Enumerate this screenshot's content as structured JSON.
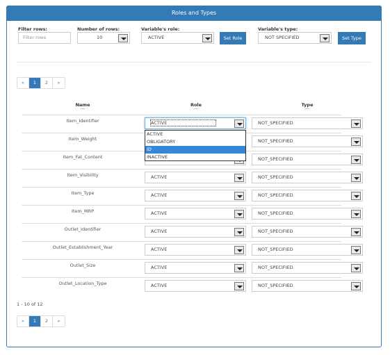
{
  "header": {
    "title": "Roles and Types"
  },
  "controls": {
    "filter_label": "Filter rows:",
    "filter_placeholder": "Filter rows",
    "rows_label": "Number of rows:",
    "rows_value": "10",
    "role_label": "Variable's role:",
    "role_value": "ACTIVE",
    "set_role": "Set Role",
    "type_label": "Variable's type:",
    "type_value": "NOT SPECIFIED",
    "set_type": "Set Type"
  },
  "pagination": {
    "prev": "«",
    "pages": [
      "1",
      "2"
    ],
    "active": "1",
    "next": "»"
  },
  "table": {
    "headers": [
      "Name",
      "Role",
      "Type"
    ],
    "rows": [
      {
        "name": "Item_Identifier",
        "role": "ACTIVE",
        "type": "NOT_SPECIFIED"
      },
      {
        "name": "Item_Weight",
        "role": "ACTIVE",
        "type": "NOT_SPECIFIED"
      },
      {
        "name": "Item_Fat_Content",
        "role": "ACTIVE",
        "type": "NOT_SPECIFIED"
      },
      {
        "name": "Item_Visibility",
        "role": "ACTIVE",
        "type": "NOT_SPECIFIED"
      },
      {
        "name": "Item_Type",
        "role": "ACTIVE",
        "type": "NOT_SPECIFIED"
      },
      {
        "name": "Item_MRP",
        "role": "ACTIVE",
        "type": "NOT_SPECIFIED"
      },
      {
        "name": "Outlet_Identifier",
        "role": "ACTIVE",
        "type": "NOT_SPECIFIED"
      },
      {
        "name": "Outlet_Establishment_Year",
        "role": "ACTIVE",
        "type": "NOT_SPECIFIED"
      },
      {
        "name": "Outlet_Size",
        "role": "ACTIVE",
        "type": "NOT_SPECIFIED"
      },
      {
        "name": "Outlet_Location_Type",
        "role": "ACTIVE",
        "type": "NOT_SPECIFIED"
      }
    ]
  },
  "dropdown": {
    "options": [
      "ACTIVE",
      "OBLIGATORY",
      "ID",
      "INACTIVE"
    ],
    "highlighted": "ID"
  },
  "footer": {
    "count": "1 - 10 of 12"
  },
  "colors": {
    "accent": "#337ab7",
    "highlight": "#3388dd"
  }
}
